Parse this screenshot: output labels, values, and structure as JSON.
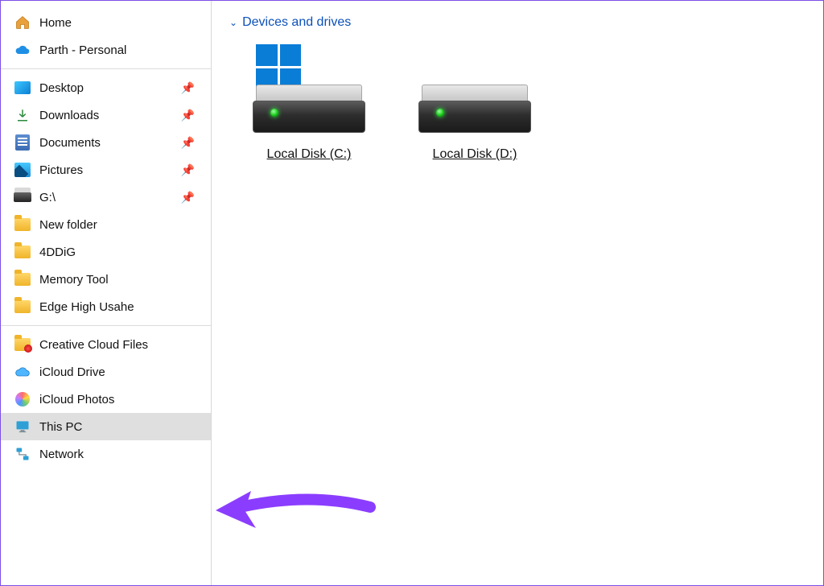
{
  "sidebar": {
    "home_items": [
      {
        "label": "Home",
        "icon": "home-icon"
      },
      {
        "label": "Parth - Personal",
        "icon": "cloud-icon"
      }
    ],
    "quick_items": [
      {
        "label": "Desktop",
        "icon": "desktop-icon",
        "pinned": true
      },
      {
        "label": "Downloads",
        "icon": "download-icon",
        "pinned": true
      },
      {
        "label": "Documents",
        "icon": "document-icon",
        "pinned": true
      },
      {
        "label": "Pictures",
        "icon": "pictures-icon",
        "pinned": true
      },
      {
        "label": "G:\\",
        "icon": "drive-g-icon",
        "pinned": true
      },
      {
        "label": "New folder",
        "icon": "folder-icon",
        "pinned": false
      },
      {
        "label": "4DDiG",
        "icon": "folder-icon",
        "pinned": false
      },
      {
        "label": "Memory Tool",
        "icon": "folder-icon",
        "pinned": false
      },
      {
        "label": "Edge High Usahe",
        "icon": "folder-icon",
        "pinned": false
      }
    ],
    "locations": [
      {
        "label": "Creative Cloud Files",
        "icon": "creative-cloud-folder-icon"
      },
      {
        "label": "iCloud Drive",
        "icon": "icloud-drive-icon"
      },
      {
        "label": "iCloud Photos",
        "icon": "icloud-photos-icon"
      },
      {
        "label": "This PC",
        "icon": "this-pc-icon",
        "selected": true
      },
      {
        "label": "Network",
        "icon": "network-icon"
      }
    ]
  },
  "main": {
    "section_title": "Devices and drives",
    "drives": [
      {
        "label": "Local Disk (C:)",
        "os_badge": true
      },
      {
        "label": "Local Disk (D:)",
        "os_badge": false
      }
    ]
  },
  "colors": {
    "accent": "#0c50ba",
    "arrow": "#8b3dff"
  }
}
